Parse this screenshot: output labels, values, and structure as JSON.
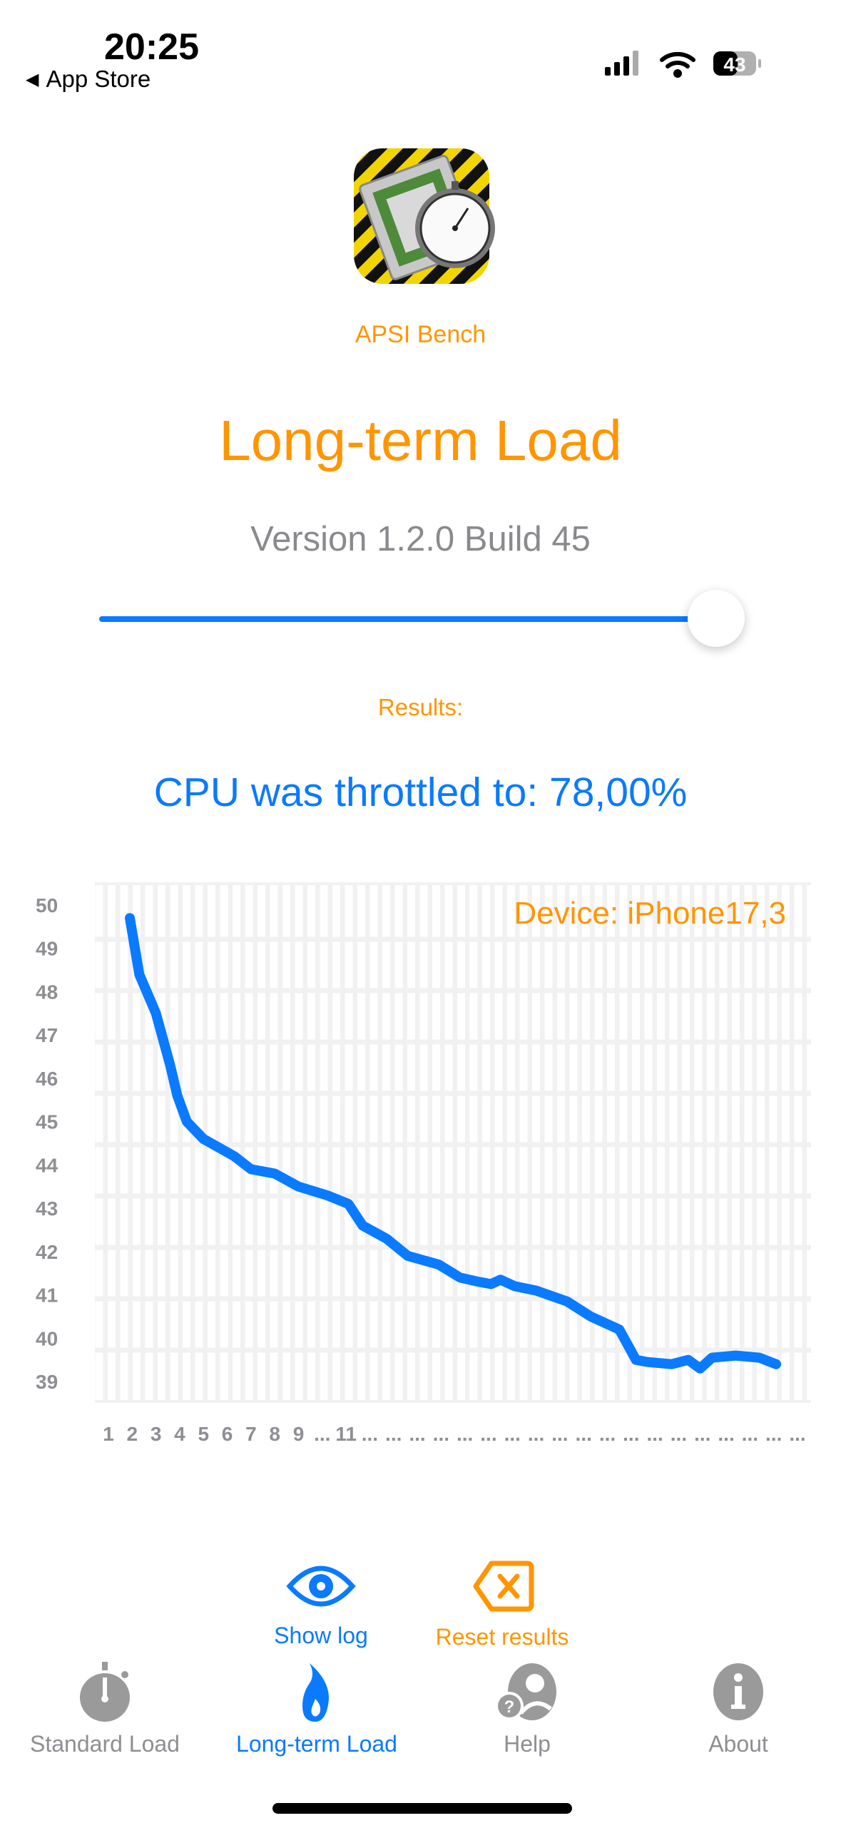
{
  "status_bar": {
    "time": "20:25",
    "back_label": "App Store",
    "battery": "43"
  },
  "header": {
    "app_name": "APSI Bench",
    "title": "Long-term Load",
    "version": "Version 1.2.0 Build 45"
  },
  "slider": {
    "value": 1.0
  },
  "results": {
    "label": "Results:",
    "throttle_text": "CPU was throttled to: 78,00%"
  },
  "colors": {
    "accent_blue": "#0A7AFF",
    "accent_orange": "#FF9500",
    "inactive_gray": "#8e8e93"
  },
  "chart_data": {
    "type": "line",
    "annotation": "Device: iPhone17,3",
    "y_ticks": [
      "50",
      "49",
      "48",
      "47",
      "46",
      "45",
      "44",
      "43",
      "42",
      "41",
      "40",
      "39"
    ],
    "x_ticks": [
      "1",
      "2",
      "3",
      "4",
      "5",
      "6",
      "7",
      "8",
      "9",
      "...",
      "11",
      "...",
      "...",
      "...",
      "...",
      "...",
      "...",
      "...",
      "...",
      "...",
      "...",
      "...",
      "...",
      "...",
      "...",
      "...",
      "...",
      "...",
      "...",
      "..."
    ],
    "ylim": [
      39,
      50
    ],
    "grid": true,
    "series": [
      {
        "x": [
          1.9,
          2.3,
          3.0,
          3.6,
          3.9,
          4.3,
          5.0,
          6.3,
          7.0,
          8.0,
          9.0,
          10.2,
          11.1,
          11.7,
          12.7,
          13.6,
          14.9,
          15.8,
          16.6,
          17.1,
          17.5,
          18.1,
          19.0,
          20.3,
          21.3,
          22.5,
          23.2,
          23.7,
          24.7,
          25.4,
          25.9,
          26.4,
          27.4,
          28.4,
          29.1
        ],
        "y": [
          49.7,
          48.4,
          47.5,
          46.3,
          45.6,
          45.0,
          44.6,
          44.2,
          43.9,
          43.8,
          43.5,
          43.3,
          43.1,
          42.6,
          42.3,
          41.9,
          41.7,
          41.4,
          41.3,
          41.25,
          41.35,
          41.2,
          41.1,
          40.85,
          40.5,
          40.2,
          39.5,
          39.45,
          39.4,
          39.5,
          39.3,
          39.55,
          39.6,
          39.55,
          39.4
        ]
      }
    ],
    "line_color": "#0A7AFF"
  },
  "actions": {
    "show_log": "Show log",
    "reset_results": "Reset results"
  },
  "tabs": [
    {
      "label": "Standard Load",
      "icon": "stopwatch-icon",
      "active": false
    },
    {
      "label": "Long-term Load",
      "icon": "flame-icon",
      "active": true
    },
    {
      "label": "Help",
      "icon": "help-person-icon",
      "active": false
    },
    {
      "label": "About",
      "icon": "info-icon",
      "active": false
    }
  ]
}
